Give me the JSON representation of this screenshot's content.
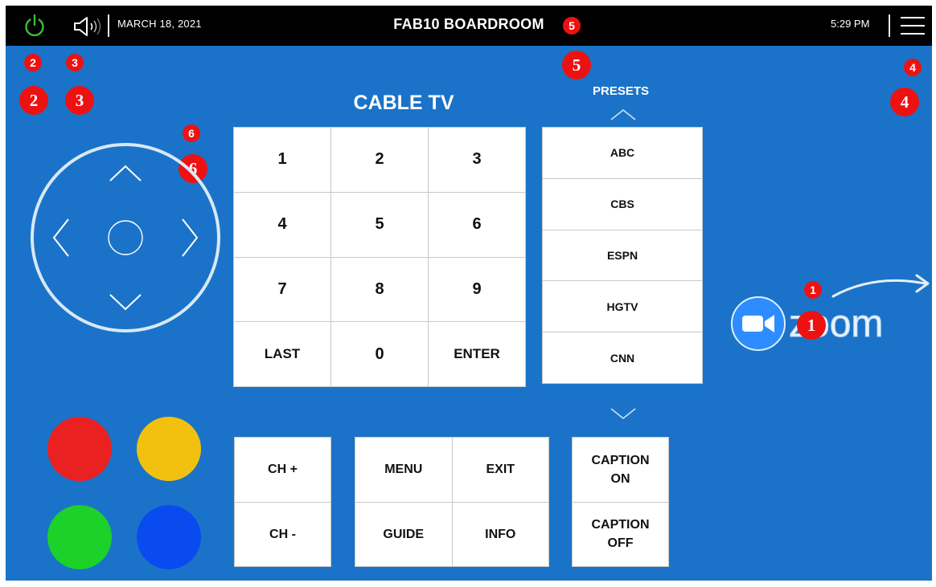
{
  "topbar": {
    "date": "MARCH 18, 2021",
    "room": "FAB10 BOARDROOM",
    "time": "5:29 PM"
  },
  "title": "CABLE TV",
  "presets_label": "PRESETS",
  "keypad": [
    "1",
    "2",
    "3",
    "4",
    "5",
    "6",
    "7",
    "8",
    "9",
    "LAST",
    "0",
    "ENTER"
  ],
  "presets": [
    "ABC",
    "CBS",
    "ESPN",
    "HGTV",
    "CNN"
  ],
  "channel": {
    "up": "CH +",
    "down": "CH -"
  },
  "nav": {
    "menu": "MENU",
    "exit": "EXIT",
    "guide": "GUIDE",
    "info": "INFO"
  },
  "caption": {
    "on": "CAPTION\nON",
    "off": "CAPTION\nOFF"
  },
  "color_buttons": {
    "red": "#ea2121",
    "yellow": "#f2c10f",
    "green": "#1bd12a",
    "blue": "#0a4bf0"
  },
  "callouts": {
    "zoom": "1",
    "power": "2",
    "volume": "3",
    "menu": "4",
    "title": "5",
    "dpad": "6"
  },
  "zoom_logo": "zoom",
  "colors": {
    "background": "#1a73c8",
    "topbar": "#000000",
    "callout": "#e11111"
  },
  "icons": [
    "power-icon",
    "speaker-icon",
    "menu-icon",
    "chevron-up-icon",
    "chevron-down-icon",
    "chevron-left-icon",
    "chevron-right-icon",
    "zoom-camera-icon",
    "curved-arrow-icon"
  ]
}
